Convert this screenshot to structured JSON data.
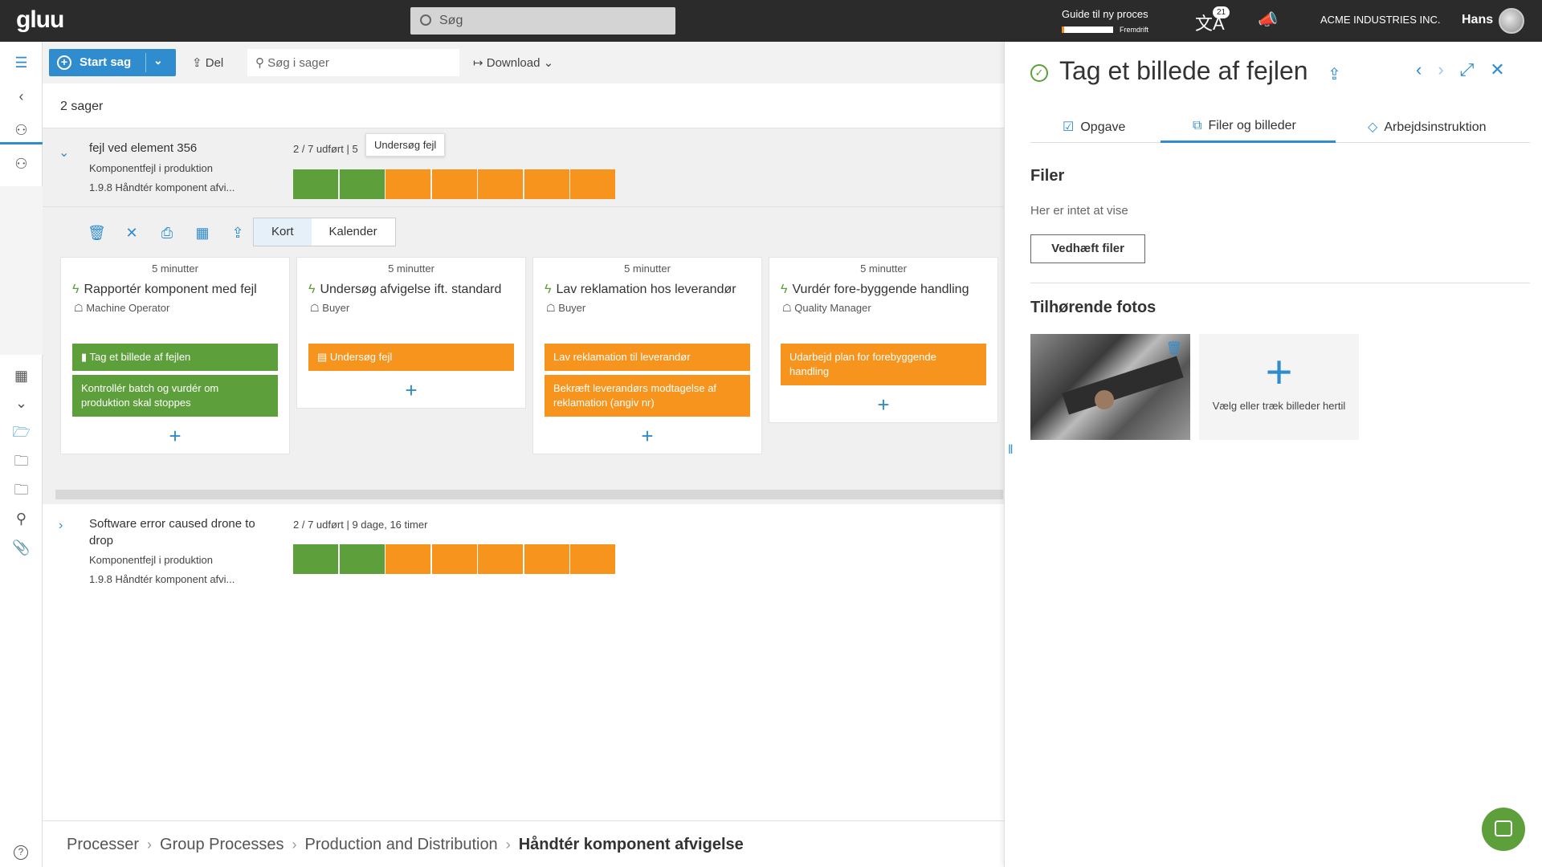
{
  "topbar": {
    "logo": "gluu",
    "search_placeholder": "Søg",
    "guide_title": "Guide til ny proces",
    "guide_sub": "Fremdrift",
    "guide_progress": 0.05,
    "notif_count": "21",
    "company": "ACME INDUSTRIES INC.",
    "user": "Hans"
  },
  "toolbar": {
    "start_label": "Start sag",
    "share_label": "Del",
    "search_placeholder": "Søg i sager",
    "download_label": "Download"
  },
  "list": {
    "count": "2 sager"
  },
  "cases": [
    {
      "title": "fejl ved element 356",
      "category": "Komponentfejl i produktion",
      "process": "1.9.8 Håndtér komponent afvi...",
      "progress": "2 / 7 udført  |  5",
      "tooltip": "Undersøg fejl"
    },
    {
      "title": "Software error caused drone to drop",
      "category": "Komponentfejl i produktion",
      "process": "1.9.8 Håndtér komponent afvi...",
      "progress": "2 / 7 udført  |  9 dage, 16 timer"
    }
  ],
  "view_toggle": {
    "map": "Kort",
    "calendar": "Kalender"
  },
  "columns": [
    {
      "duration": "5 minutter",
      "task": "Rapportér komponent med fejl",
      "role": "Machine Operator",
      "cards": [
        {
          "text": "Tag et billede af fejlen",
          "color": "#5da03b"
        },
        {
          "text": "Kontrollér batch og vurdér om produktion skal stoppes",
          "color": "#5da03b"
        }
      ]
    },
    {
      "duration": "5 minutter",
      "task": "Undersøg afvigelse ift. standard",
      "role": "Buyer",
      "cards": [
        {
          "text": "Undersøg fejl",
          "color": "#f7941d"
        }
      ]
    },
    {
      "duration": "5 minutter",
      "task": "Lav reklamation hos leverandør",
      "role": "Buyer",
      "cards": [
        {
          "text": "Lav reklamation til leverandør",
          "color": "#f7941d"
        },
        {
          "text": "Bekræft leverandørs modtagelse af reklamation (angiv nr)",
          "color": "#f7941d"
        }
      ]
    },
    {
      "duration": "5 minutter",
      "task": "Vurdér fore-byggende handling",
      "role": "Quality Manager",
      "cards": [
        {
          "text": "Udarbejd plan for forebyggende handling",
          "color": "#f7941d"
        }
      ]
    }
  ],
  "breadcrumb": {
    "items": [
      "Processer",
      "Group Processes",
      "Production and Distribution"
    ],
    "current": "Håndtér komponent afvigelse"
  },
  "panel": {
    "title": "Tag et billede af fejlen",
    "tabs": [
      "Opgave",
      "Filer og billeder",
      "Arbejdsinstruktion"
    ],
    "files_heading": "Filer",
    "files_empty": "Her er intet at vise",
    "attach_label": "Vedhæft filer",
    "photos_heading": "Tilhørende fotos",
    "dropzone_label": "Vælg eller træk billeder hertil"
  },
  "colors": {
    "accent": "#2e8ccf",
    "done": "#5da03b",
    "pending": "#f7941d"
  }
}
